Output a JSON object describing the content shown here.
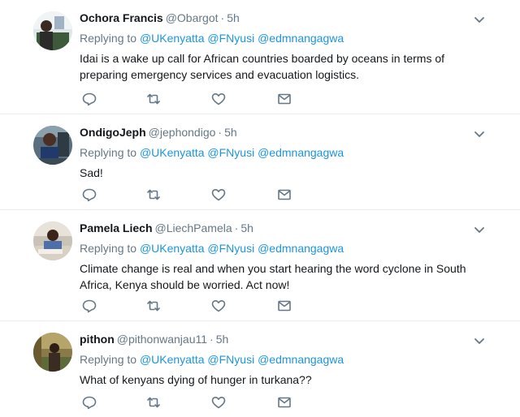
{
  "replying_prefix": "Replying to",
  "tweets": [
    {
      "fullname": "Ochora Francis",
      "username": "@Obargot",
      "time": "5h",
      "mentions": [
        "@UKenyatta",
        "@FNyusi",
        "@edmnangagwa"
      ],
      "text": "Idai is a wake up call for African countries boarded by oceans in terms of preparing emergency services and evacuation logistics."
    },
    {
      "fullname": "OndigoJeph",
      "username": "@jephondigo",
      "time": "5h",
      "mentions": [
        "@UKenyatta",
        "@FNyusi",
        "@edmnangagwa"
      ],
      "text": "Sad!"
    },
    {
      "fullname": "Pamela Liech",
      "username": "@LiechPamela",
      "time": "5h",
      "mentions": [
        "@UKenyatta",
        "@FNyusi",
        "@edmnangagwa"
      ],
      "text": "Climate change is real and when you start hearing the word cyclone in South Africa, Kenya should be worried. Act now!"
    },
    {
      "fullname": "pithon",
      "username": "@pithonwanjau11",
      "time": "5h",
      "mentions": [
        "@UKenyatta",
        "@FNyusi",
        "@edmnangagwa"
      ],
      "text": "What of kenyans dying of hunger in turkana??"
    }
  ],
  "icons": {
    "reply": "reply-icon",
    "retweet": "retweet-icon",
    "like": "like-icon",
    "dm": "direct-message-icon",
    "caret": "chevron-down-icon"
  },
  "colors": {
    "icon_gray": "#657786",
    "link_blue": "#1b95e0",
    "text": "#14171a",
    "border": "#e6ecf0"
  }
}
